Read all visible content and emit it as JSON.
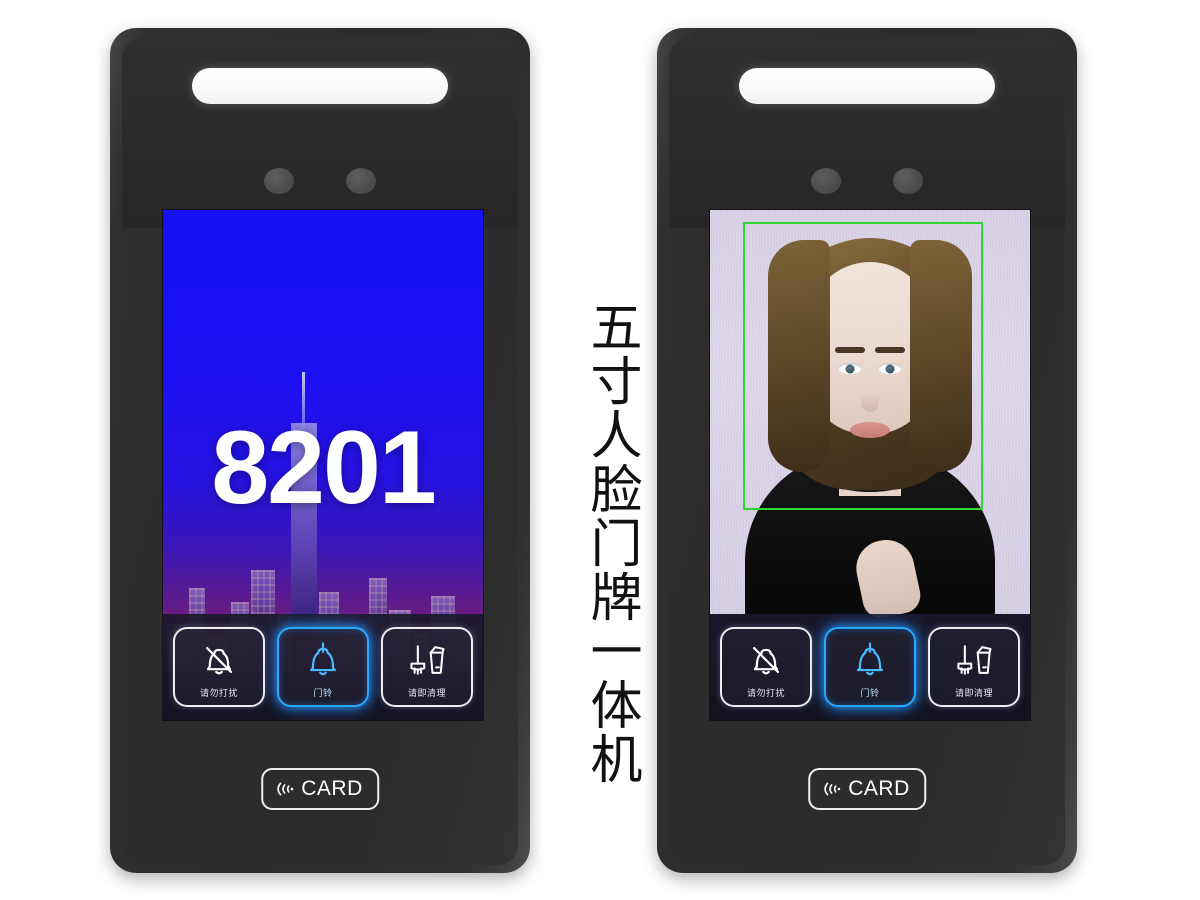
{
  "caption": {
    "text": "五寸人脸门牌一体机"
  },
  "devices": [
    {
      "id": "left-device",
      "screen_mode": "room-number",
      "room_number": "8201",
      "wallpaper": "night-city-skyline",
      "card_reader": {
        "label": "CARD",
        "icon": "rfid-wave-icon"
      },
      "buttons": [
        {
          "id": "do-not-disturb",
          "label": "请勿打扰",
          "icon": "bell-slash-icon",
          "active": false
        },
        {
          "id": "doorbell",
          "label": "门铃",
          "icon": "bell-icon",
          "active": true
        },
        {
          "id": "clean-room",
          "label": "请即清理",
          "icon": "broom-trash-icon",
          "active": false
        }
      ]
    },
    {
      "id": "right-device",
      "screen_mode": "face-recognition",
      "room_number": "",
      "wallpaper": "live-camera-feed",
      "detection_box_color": "#2fd82f",
      "card_reader": {
        "label": "CARD",
        "icon": "rfid-wave-icon"
      },
      "buttons": [
        {
          "id": "do-not-disturb",
          "label": "请勿打扰",
          "icon": "bell-slash-icon",
          "active": false
        },
        {
          "id": "doorbell",
          "label": "门铃",
          "icon": "bell-icon",
          "active": true
        },
        {
          "id": "clean-room",
          "label": "请即清理",
          "icon": "broom-trash-icon",
          "active": false
        }
      ]
    }
  ],
  "colors": {
    "background": "#ffffff",
    "device_body": "#2c2c2c",
    "led_bar": "#ffffff",
    "active_button": "#2aa8ff",
    "detect_box": "#2fd82f",
    "sky_blue": "#1710f5"
  }
}
